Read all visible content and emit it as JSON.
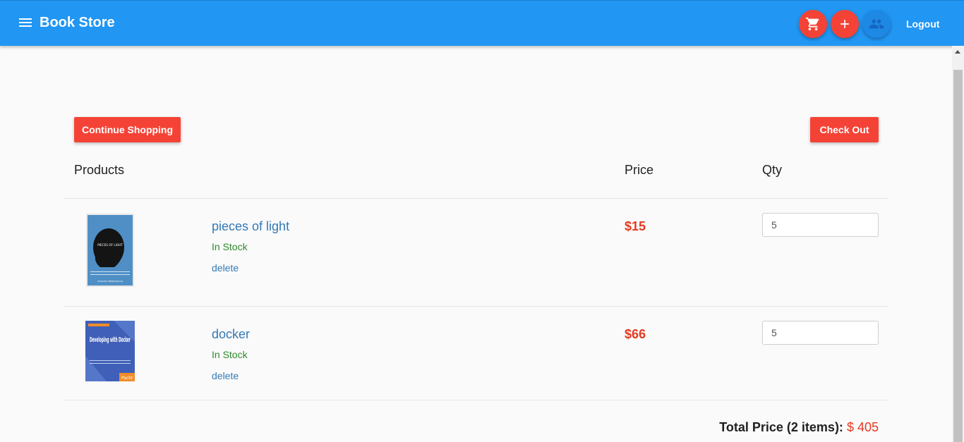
{
  "header": {
    "title": "Book Store",
    "logout_label": "Logout",
    "icons": [
      "menu-icon",
      "cart-icon",
      "add-icon",
      "users-icon"
    ]
  },
  "toolbar": {
    "continue_label": "Continue Shopping",
    "checkout_label": "Check Out"
  },
  "table": {
    "columns": [
      "Products",
      "Price",
      "Qty"
    ]
  },
  "cart": {
    "items": [
      {
        "title": "pieces of light",
        "stock": "In Stock",
        "delete_label": "delete",
        "price": "$15",
        "qty": "5",
        "cover": {
          "title": "PIECES OF LIGHT",
          "author": "CHARLES FERNYHOUGH"
        }
      },
      {
        "title": "docker",
        "stock": "In Stock",
        "delete_label": "delete",
        "price": "$66",
        "qty": "5",
        "cover": {
          "title": "Developing with Docker",
          "publisher": "Packt"
        }
      }
    ]
  },
  "summary": {
    "label": "Total Price (2 items):",
    "amount": "$ 405"
  },
  "colors": {
    "appbar": "#2196f3",
    "accent": "#f44336",
    "price": "#e53a21",
    "link": "#337ab7",
    "stock": "#2e8b2e"
  }
}
